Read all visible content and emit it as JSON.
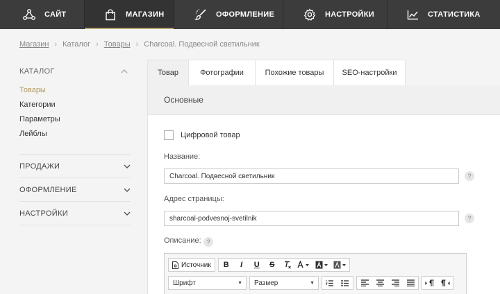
{
  "nav": {
    "site": "САЙТ",
    "shop": "МАГАЗИН",
    "design": "ОФОРМЛЕНИЕ",
    "settings": "НАСТРОЙКИ",
    "stats": "СТАТИСТИКА"
  },
  "breadcrumb": {
    "shop": "Магазин",
    "catalog": "Каталог",
    "products": "Товары",
    "current": "Charcoal. Подвесной светильник"
  },
  "sidebar": {
    "catalog_title": "КАТАЛОГ",
    "items": [
      "Товары",
      "Категории",
      "Параметры",
      "Лейблы"
    ],
    "sections": [
      "ПРОДАЖИ",
      "ОФОРМЛЕНИЕ",
      "НАСТРОЙКИ"
    ]
  },
  "tabs": [
    "Товар",
    "Фотографии",
    "Похожие товары",
    "SEO-настройки"
  ],
  "panel": {
    "title": "Основные",
    "digital_label": "Цифровой товар",
    "name_label": "Название:",
    "name_value": "Charcoal. Подвесной светильник",
    "url_label": "Адрес страницы:",
    "url_value": "sharcoal-podvesnoj-svetilnik",
    "desc_label": "Описание:",
    "help_glyph": "?"
  },
  "editor": {
    "source_label": "Источник",
    "bold": "B",
    "italic": "I",
    "underline": "U",
    "strike": "S",
    "font_combo": "Шрифт",
    "size_combo": "Размер"
  },
  "colors": {
    "nav_bg": "#3c3c3c",
    "accent": "#b9a36f",
    "active_link": "#b39a5e"
  }
}
